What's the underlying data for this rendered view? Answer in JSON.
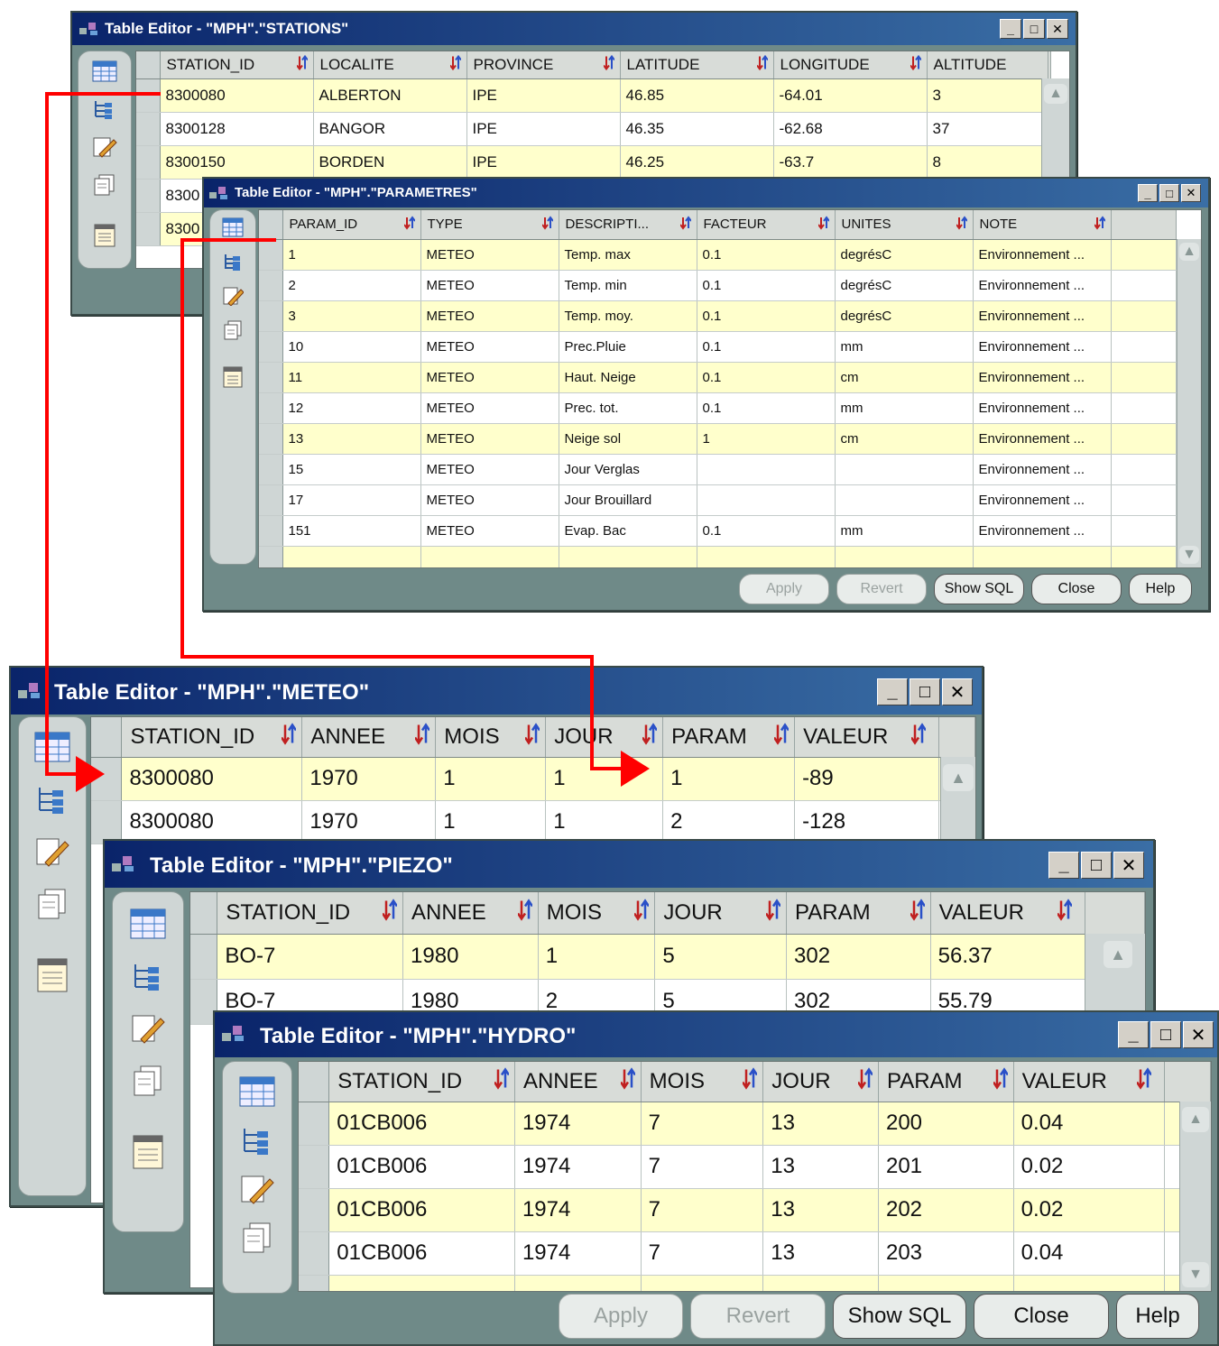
{
  "icons": {
    "app": "app-icon",
    "grid": "table-grid-icon",
    "tree": "tree-icon",
    "edit": "edit-pencil-icon",
    "copy": "copy-pages-icon",
    "sheet": "sheet-icon",
    "sort": "sort-icon",
    "minimize": "minimize-icon",
    "maximize": "maximize-icon",
    "close": "close-icon"
  },
  "colors": {
    "title_gradient_start": "#0a246a",
    "title_gradient_end": "#3a6ea5",
    "window_bg": "#6f8a88",
    "highlight_row": "#ffffcc",
    "arrow": "#ff0000"
  },
  "window_controls": {
    "minimize": "_",
    "maximize": "□",
    "close": "✕"
  },
  "windows": [
    {
      "id": "stations",
      "title": "Table Editor - \"MPH\".\"STATIONS\"",
      "columns": [
        "STATION_ID",
        "LOCALITE",
        "PROVINCE",
        "LATITUDE",
        "LONGITUDE",
        "ALTITUDE"
      ],
      "rows": [
        [
          "8300080",
          "ALBERTON",
          "IPE",
          "46.85",
          "-64.01",
          "3"
        ],
        [
          "8300128",
          "BANGOR",
          "IPE",
          "46.35",
          "-62.68",
          "37"
        ],
        [
          "8300150",
          "BORDEN",
          "IPE",
          "46.25",
          "-63.7",
          "8"
        ],
        [
          "8300",
          "",
          "",
          "",
          "",
          ""
        ],
        [
          "8300",
          "",
          "",
          "",
          "",
          ""
        ]
      ]
    },
    {
      "id": "parametres",
      "title": "Table Editor - \"MPH\".\"PARAMETRES\"",
      "columns": [
        "PARAM_ID",
        "TYPE",
        "DESCRIPTI...",
        "FACTEUR",
        "UNITES",
        "NOTE"
      ],
      "rows": [
        [
          "1",
          "METEO",
          "Temp. max",
          "0.1",
          "degrésC",
          "Environnement ..."
        ],
        [
          "2",
          "METEO",
          "Temp. min",
          "0.1",
          "degrésC",
          "Environnement ..."
        ],
        [
          "3",
          "METEO",
          "Temp. moy.",
          "0.1",
          "degrésC",
          "Environnement ..."
        ],
        [
          "10",
          "METEO",
          "Prec.Pluie",
          "0.1",
          "mm",
          "Environnement ..."
        ],
        [
          "11",
          "METEO",
          "Haut. Neige",
          "0.1",
          "cm",
          "Environnement ..."
        ],
        [
          "12",
          "METEO",
          "Prec. tot.",
          "0.1",
          "mm",
          "Environnement ..."
        ],
        [
          "13",
          "METEO",
          "Neige sol",
          "1",
          "cm",
          "Environnement ..."
        ],
        [
          "15",
          "METEO",
          "Jour Verglas",
          "",
          "",
          "Environnement ..."
        ],
        [
          "17",
          "METEO",
          "Jour Brouillard",
          "",
          "",
          "Environnement ..."
        ],
        [
          "151",
          "METEO",
          "Evap. Bac",
          "0.1",
          "mm",
          "Environnement ..."
        ],
        [
          "",
          "",
          "",
          "",
          "",
          ""
        ]
      ],
      "buttons": [
        "Apply",
        "Revert",
        "Show SQL",
        "Close",
        "Help"
      ]
    },
    {
      "id": "meteo",
      "title": "Table Editor - \"MPH\".\"METEO\"",
      "columns": [
        "STATION_ID",
        "ANNEE",
        "MOIS",
        "JOUR",
        "PARAM",
        "VALEUR"
      ],
      "rows": [
        [
          "8300080",
          "1970",
          "1",
          "1",
          "1",
          "-89"
        ],
        [
          "8300080",
          "1970",
          "1",
          "1",
          "2",
          "-128"
        ]
      ]
    },
    {
      "id": "piezo",
      "title": "Table Editor - \"MPH\".\"PIEZO\"",
      "columns": [
        "STATION_ID",
        "ANNEE",
        "MOIS",
        "JOUR",
        "PARAM",
        "VALEUR"
      ],
      "rows": [
        [
          "BO-7",
          "1980",
          "1",
          "5",
          "302",
          "56.37"
        ],
        [
          "BO-7",
          "1980",
          "2",
          "5",
          "302",
          "55.79"
        ]
      ]
    },
    {
      "id": "hydro",
      "title": "Table Editor - \"MPH\".\"HYDRO\"",
      "columns": [
        "STATION_ID",
        "ANNEE",
        "MOIS",
        "JOUR",
        "PARAM",
        "VALEUR"
      ],
      "rows": [
        [
          "01CB006",
          "1974",
          "7",
          "13",
          "200",
          "0.04"
        ],
        [
          "01CB006",
          "1974",
          "7",
          "13",
          "201",
          "0.02"
        ],
        [
          "01CB006",
          "1974",
          "7",
          "13",
          "202",
          "0.02"
        ],
        [
          "01CB006",
          "1974",
          "7",
          "13",
          "203",
          "0.04"
        ],
        [
          "",
          "",
          "",
          "",
          "",
          ""
        ]
      ],
      "buttons": [
        "Apply",
        "Revert",
        "Show SQL",
        "Close",
        "Help"
      ]
    }
  ]
}
